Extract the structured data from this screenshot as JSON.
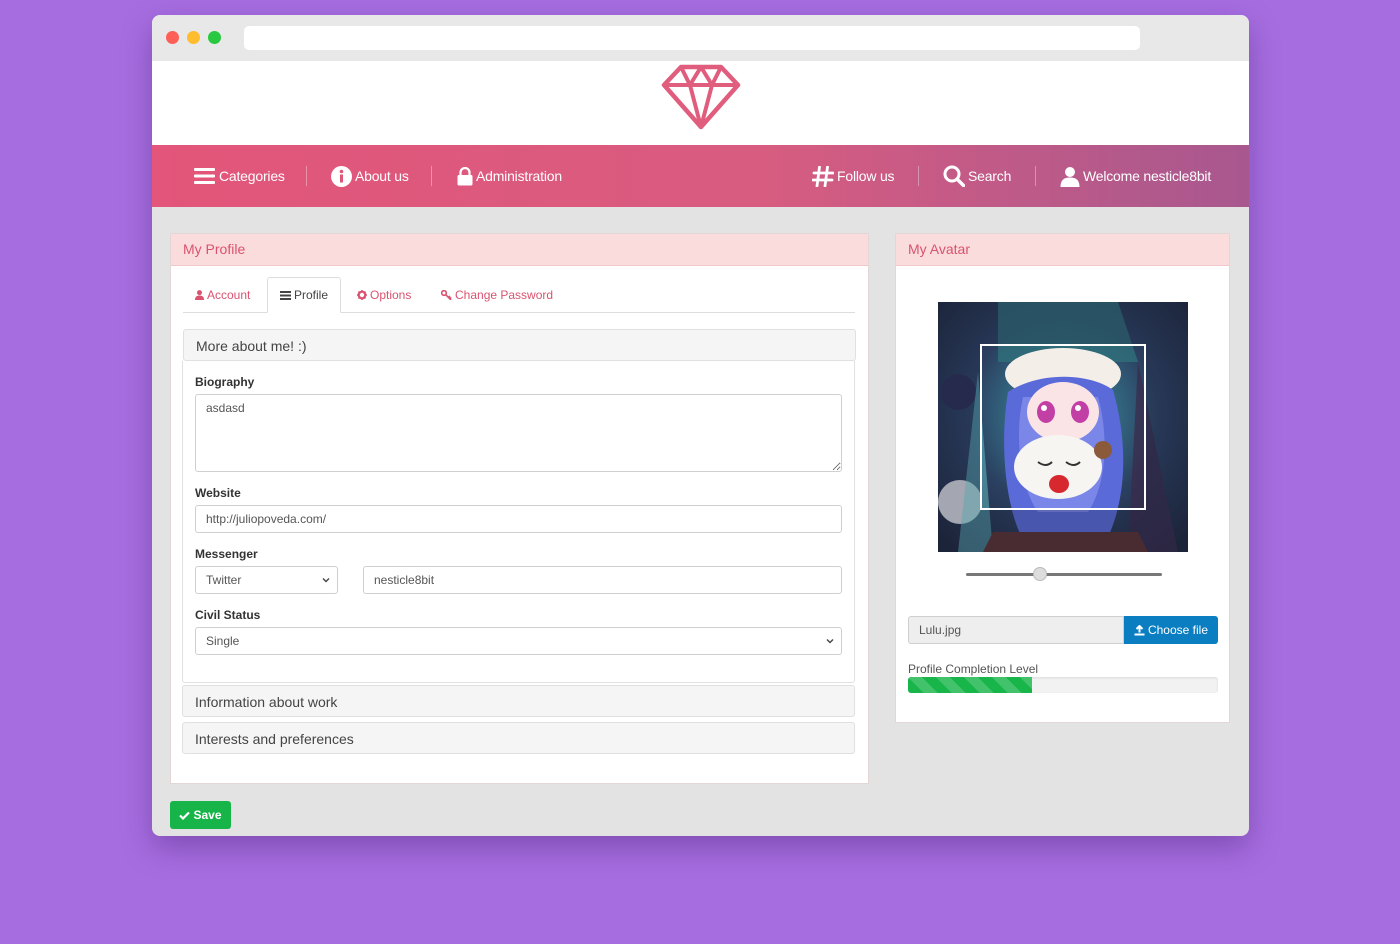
{
  "nav": {
    "categories": "Categories",
    "about": "About us",
    "administration": "Administration",
    "follow": "Follow us",
    "search": "Search",
    "welcome": "Welcome nesticle8bit"
  },
  "profile": {
    "heading": "My Profile",
    "tabs": {
      "account": "Account",
      "profile": "Profile",
      "options": "Options",
      "password": "Change Password"
    },
    "sections": {
      "more": "More about me! :)",
      "work": "Information about work",
      "interests": "Interests and preferences"
    },
    "fields": {
      "biography_label": "Biography",
      "biography_value": "asdasd",
      "website_label": "Website",
      "website_value": "http://juliopoveda.com/",
      "messenger_label": "Messenger",
      "messenger_service": "Twitter",
      "messenger_value": "nesticle8bit",
      "civil_label": "Civil Status",
      "civil_value": "Single"
    },
    "save_label": "Save"
  },
  "avatar": {
    "heading": "My Avatar",
    "file_name": "Lulu.jpg",
    "choose_label": "Choose file",
    "progress_label": "Profile Completion Level",
    "progress": 0.4,
    "zoom": 0.38
  },
  "colors": {
    "accent": "#d9536f",
    "success": "#16b449",
    "primary": "#0b7ec1"
  }
}
